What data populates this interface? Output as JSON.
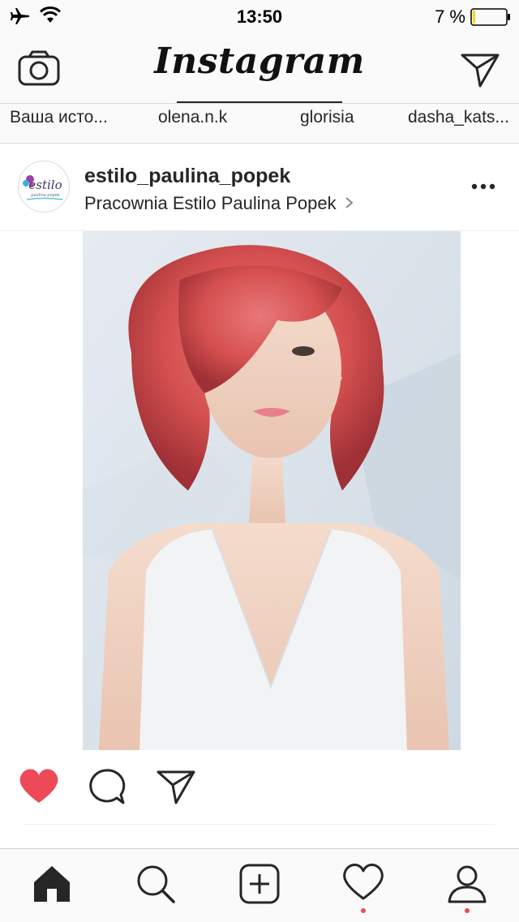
{
  "status_bar": {
    "time": "13:50",
    "battery_percent": "7 %",
    "battery_level": 0.07,
    "icons": [
      "airplane-icon",
      "wifi-icon",
      "battery-icon"
    ]
  },
  "header": {
    "title": "Instagram",
    "left_icon": "camera-icon",
    "right_icon": "direct-send-icon"
  },
  "stories": [
    {
      "label": "Ваша исто..."
    },
    {
      "label": "olena.n.k"
    },
    {
      "label": "glorisia"
    },
    {
      "label": "dasha_kats..."
    }
  ],
  "post": {
    "avatar_text": "estilo",
    "avatar_subtext": "paulina popek",
    "username": "estilo_paulina_popek",
    "location": "Pracownia Estilo Paulina Popek",
    "more_icon": "more-icon",
    "liked": true,
    "actions": [
      "heart-filled-icon",
      "comment-icon",
      "share-icon"
    ]
  },
  "tabbar": {
    "items": [
      {
        "name": "home",
        "icon": "home-icon",
        "active": true
      },
      {
        "name": "search",
        "icon": "search-icon",
        "active": false
      },
      {
        "name": "add",
        "icon": "add-icon",
        "active": false
      },
      {
        "name": "activity",
        "icon": "heart-icon",
        "active": false,
        "notification": true
      },
      {
        "name": "profile",
        "icon": "profile-icon",
        "active": false,
        "notification": true
      }
    ]
  },
  "colors": {
    "like_red": "#ed4956",
    "text": "#262626",
    "border": "#dbdbdb",
    "bar_bg": "#fafafa"
  }
}
